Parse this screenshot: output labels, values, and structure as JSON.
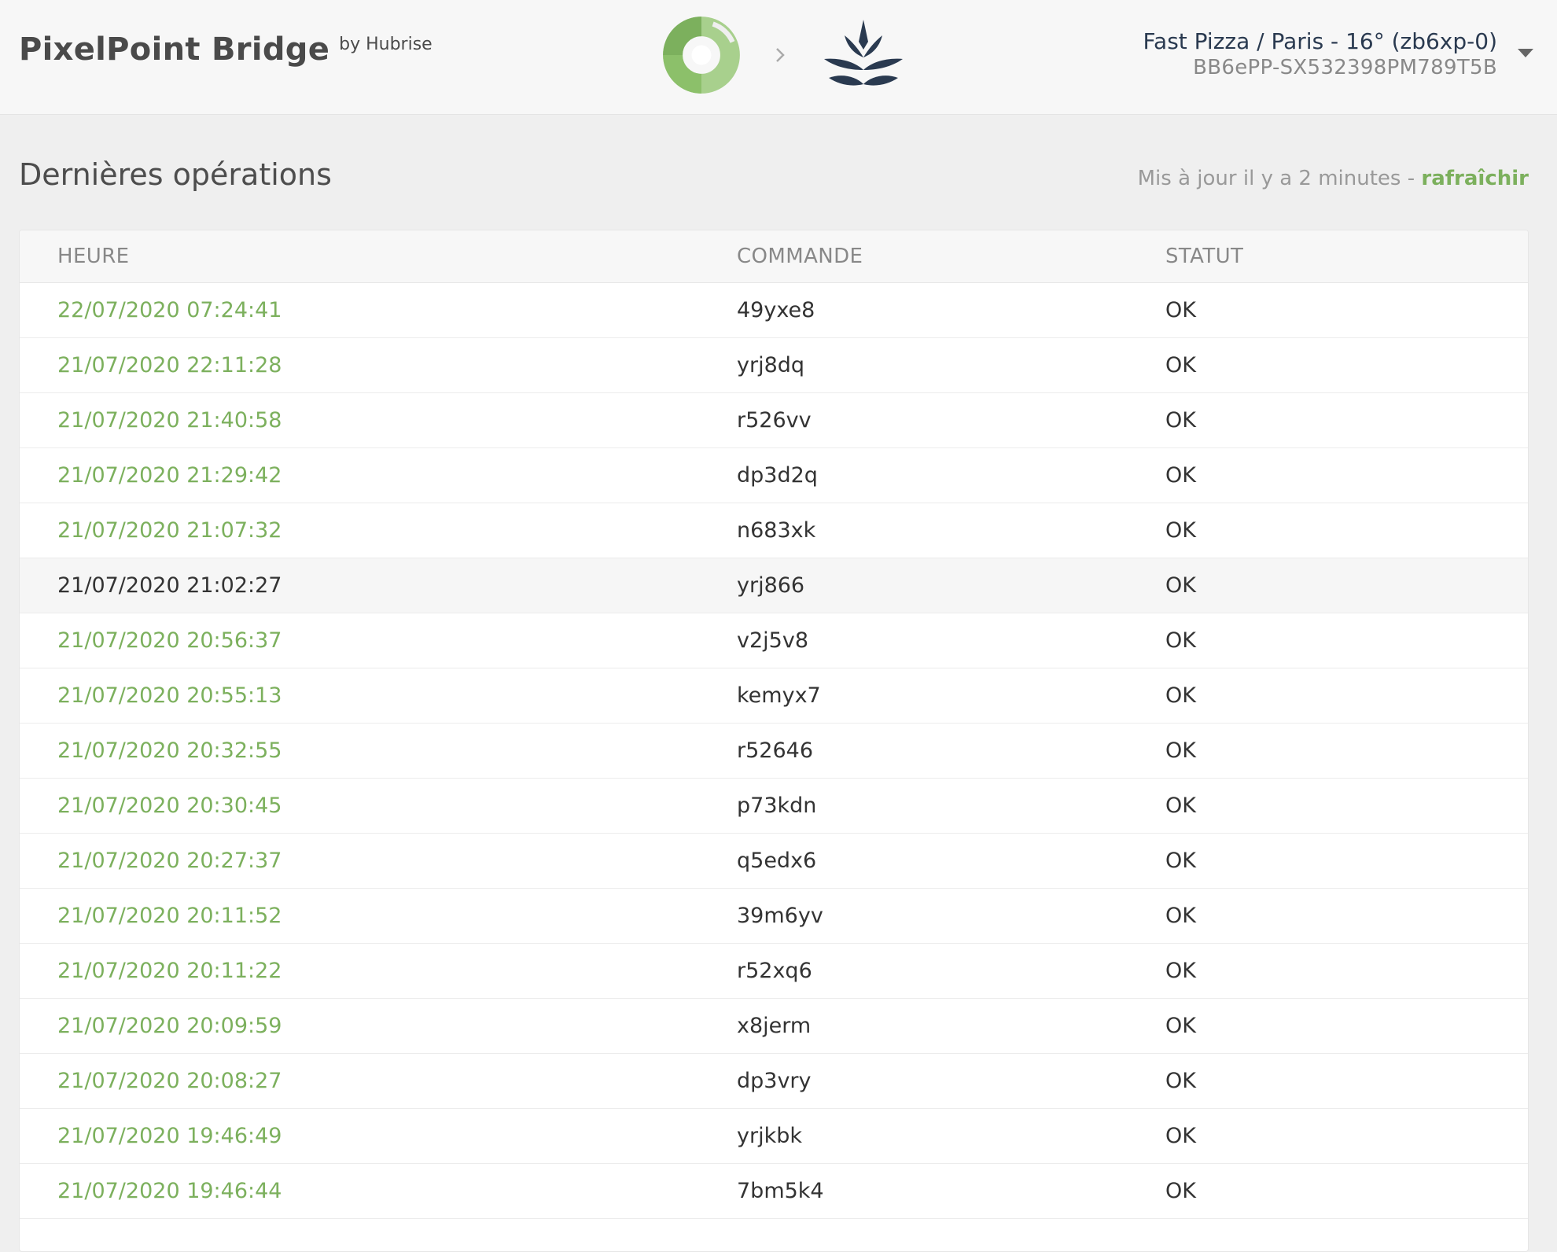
{
  "header": {
    "app_title": "PixelPoint Bridge",
    "by_label": "by Hubrise",
    "logos": {
      "left": "hubrise-logo-icon",
      "separator": "chevron-right-icon",
      "right": "pixelpoint-logo-icon"
    },
    "account": {
      "name": "Fast Pizza / Paris - 16° (zb6xp-0)",
      "id": "BB6ePP-SX532398PM789T5B"
    }
  },
  "section": {
    "title": "Dernières opérations",
    "updated_text": "Mis à jour il y a 2 minutes - ",
    "refresh_label": "rafraîchir"
  },
  "table": {
    "columns": [
      "HEURE",
      "COMMANDE",
      "STATUT"
    ],
    "rows": [
      {
        "time": "22/07/2020 07:24:41",
        "order": "49yxe8",
        "status": "OK"
      },
      {
        "time": "21/07/2020 22:11:28",
        "order": "yrj8dq",
        "status": "OK"
      },
      {
        "time": "21/07/2020 21:40:58",
        "order": "r526vv",
        "status": "OK"
      },
      {
        "time": "21/07/2020 21:29:42",
        "order": "dp3d2q",
        "status": "OK"
      },
      {
        "time": "21/07/2020 21:07:32",
        "order": "n683xk",
        "status": "OK"
      },
      {
        "time": "21/07/2020 21:02:27",
        "order": "yrj866",
        "status": "OK"
      },
      {
        "time": "21/07/2020 20:56:37",
        "order": "v2j5v8",
        "status": "OK"
      },
      {
        "time": "21/07/2020 20:55:13",
        "order": "kemyx7",
        "status": "OK"
      },
      {
        "time": "21/07/2020 20:32:55",
        "order": "r52646",
        "status": "OK"
      },
      {
        "time": "21/07/2020 20:30:45",
        "order": "p73kdn",
        "status": "OK"
      },
      {
        "time": "21/07/2020 20:27:37",
        "order": "q5edx6",
        "status": "OK"
      },
      {
        "time": "21/07/2020 20:11:52",
        "order": "39m6yv",
        "status": "OK"
      },
      {
        "time": "21/07/2020 20:11:22",
        "order": "r52xq6",
        "status": "OK"
      },
      {
        "time": "21/07/2020 20:09:59",
        "order": "x8jerm",
        "status": "OK"
      },
      {
        "time": "21/07/2020 20:08:27",
        "order": "dp3vry",
        "status": "OK"
      },
      {
        "time": "21/07/2020 19:46:49",
        "order": "yrjkbk",
        "status": "OK"
      },
      {
        "time": "21/07/2020 19:46:44",
        "order": "7bm5k4",
        "status": "OK"
      }
    ],
    "hovered_row_index": 5
  },
  "colors": {
    "accent_green": "#7cb05d",
    "navy": "#2a3a50"
  }
}
